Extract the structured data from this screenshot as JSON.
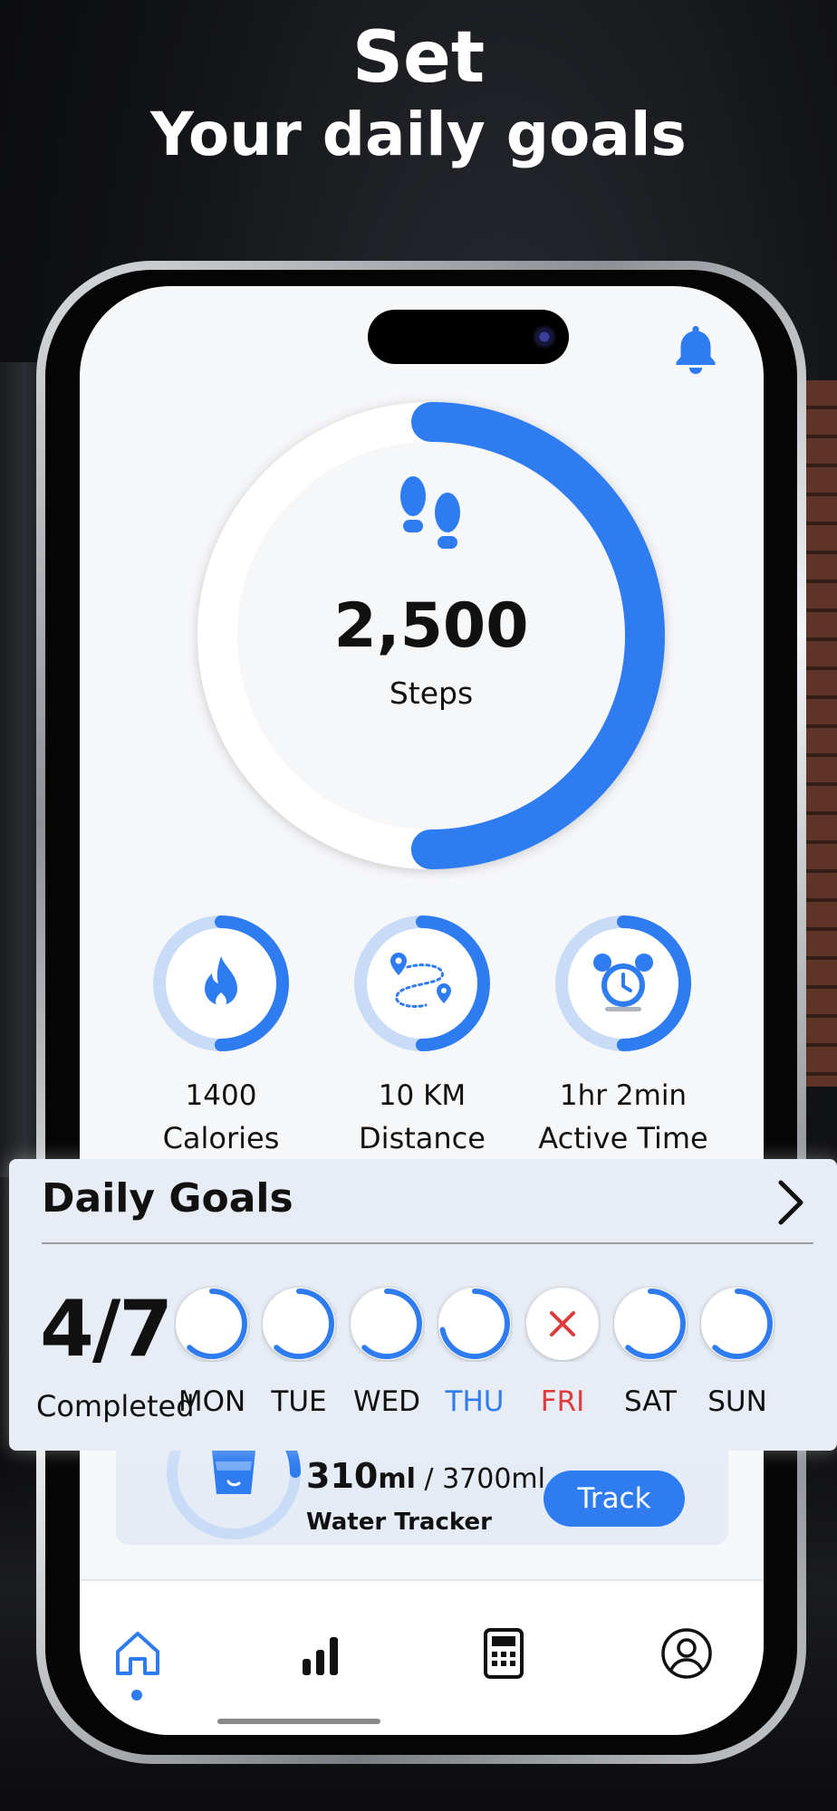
{
  "headline": {
    "line1": "Set",
    "line2": "Your daily goals"
  },
  "steps": {
    "value": "2,500",
    "label": "Steps",
    "progress": 0.5,
    "icon": "footprints-icon"
  },
  "stats": [
    {
      "value": "1400",
      "label": "Calories",
      "icon": "flame-icon",
      "progress": 0.5
    },
    {
      "value": "10 KM",
      "label": "Distance",
      "icon": "route-icon",
      "progress": 0.5
    },
    {
      "value": "1hr 2min",
      "label": "Active Time",
      "icon": "alarm-clock-icon",
      "progress": 0.5
    }
  ],
  "goals": {
    "title": "Daily Goals",
    "count": "4/7",
    "count_label": "Completed",
    "days": [
      {
        "label": "MON",
        "state": "done"
      },
      {
        "label": "TUE",
        "state": "done"
      },
      {
        "label": "WED",
        "state": "done"
      },
      {
        "label": "THU",
        "state": "active"
      },
      {
        "label": "FRI",
        "state": "missed"
      },
      {
        "label": "SAT",
        "state": "done"
      },
      {
        "label": "SUN",
        "state": "done"
      }
    ]
  },
  "water": {
    "amount": "310",
    "amount_unit": "ml",
    "separator": " / ",
    "goal": "3700ml",
    "label": "Water Tracker",
    "button": "Track",
    "progress": 0.25
  },
  "nav": [
    "home-icon",
    "stats-icon",
    "calculator-icon",
    "profile-icon"
  ],
  "colors": {
    "accent": "#2f7cf0",
    "missed": "#e03a3a",
    "track_light": "#c9dcf7",
    "screen_bg": "#f6f7f9"
  }
}
